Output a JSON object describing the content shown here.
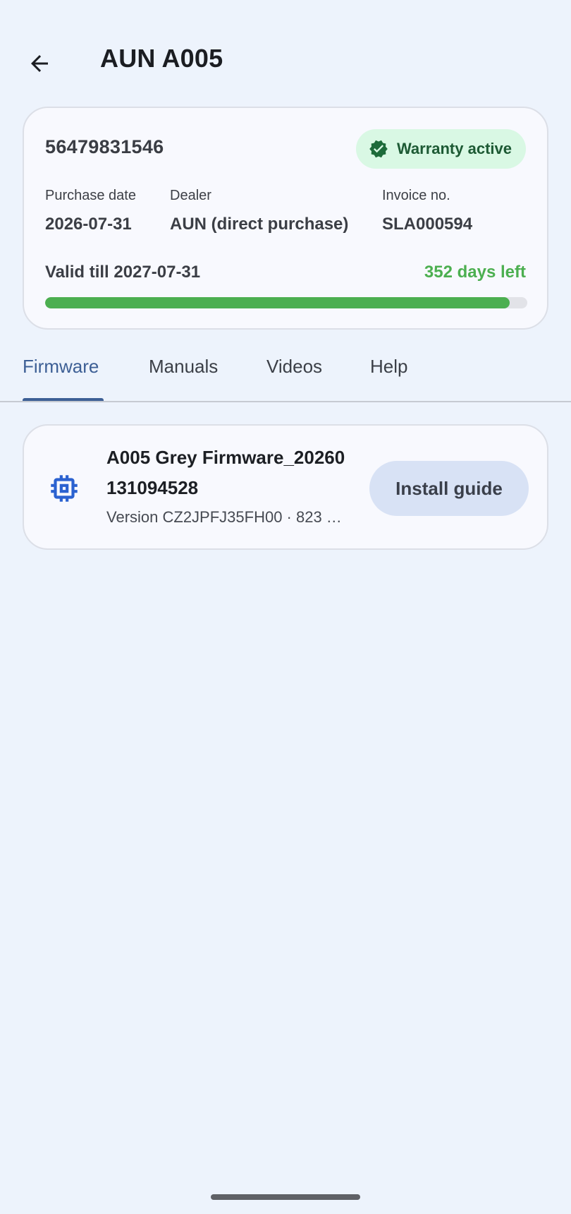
{
  "header": {
    "title": "AUN A005",
    "back_icon": "arrow-back-icon"
  },
  "warranty": {
    "serial": "56479831546",
    "badge": {
      "label": "Warranty active",
      "icon": "verified-check-icon",
      "bg_color": "#d9f8e4",
      "text_color": "#1d5a34"
    },
    "fields": [
      {
        "label": "Purchase date",
        "value": "2026-07-31"
      },
      {
        "label": "Dealer",
        "value": "AUN (direct purchase)"
      },
      {
        "label": "Invoice no.",
        "value": "SLA000594"
      }
    ],
    "valid_till": "Valid till 2027-07-31",
    "days_left": "352 days left",
    "progress_fraction": 0.964,
    "accent_color": "#4caf50"
  },
  "tabs": {
    "active_index": 0,
    "active_color": "#3d5f95",
    "items": [
      {
        "label": "Firmware"
      },
      {
        "label": "Manuals"
      },
      {
        "label": "Videos"
      },
      {
        "label": "Help"
      }
    ]
  },
  "firmware_items": [
    {
      "icon": "chip-icon",
      "title": "A005 Grey Firmware_20260131094528",
      "subtitle": "Version CZ2JPFJ35FH00 · 823 …",
      "action_label": "Install guide"
    }
  ]
}
